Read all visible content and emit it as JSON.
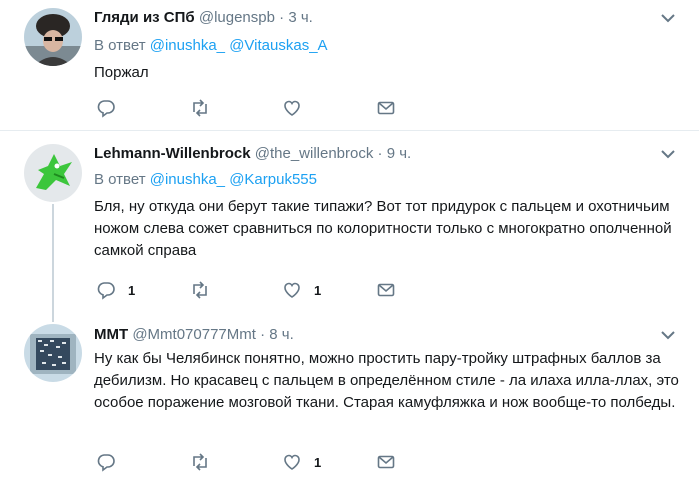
{
  "tweets": [
    {
      "name": "Гляди из СПб",
      "handle": "@lugenspb",
      "dot": "·",
      "time": "3 ч.",
      "reply_prefix": "В ответ",
      "reply_users": [
        "@inushka_",
        "@Vitauskas_A"
      ],
      "text": "Поржал",
      "counts": {
        "reply": "",
        "retweet": "",
        "like": ""
      }
    },
    {
      "name": "Lehmann-Willenbrock",
      "handle": "@the_willenbrock",
      "dot": "·",
      "time": "9 ч.",
      "reply_prefix": "В ответ",
      "reply_users": [
        "@inushka_",
        "@Karpuk555"
      ],
      "text": "Бля, ну откуда они берут такие типажи? Вот тот придурок с пальцем и охотничьим ножом слева сожет сравниться по колоритности только с многократно ополченной самкой справа",
      "counts": {
        "reply": "1",
        "retweet": "",
        "like": "1"
      }
    },
    {
      "name": "MMT",
      "handle": "@Mmt070777Mmt",
      "dot": "·",
      "time": "8 ч.",
      "text": "Ну как бы Челябинск понятно, можно простить пару-тройку штрафных баллов за дебилизм. Но красавец с пальцем в определённом стиле - ла илаха илла-ллах, это особое поражение мозговой ткани. Старая камуфляжка и нож вообще-то полбеды.",
      "counts": {
        "reply": "",
        "retweet": "",
        "like": "1"
      }
    }
  ],
  "icons": {
    "reply": "reply-icon",
    "retweet": "retweet-icon",
    "like": "heart-icon",
    "dm": "envelope-icon",
    "more": "chevron-down-icon"
  },
  "colors": {
    "link": "#1da1f2",
    "muted": "#657786",
    "divider": "#e6ecf0"
  }
}
